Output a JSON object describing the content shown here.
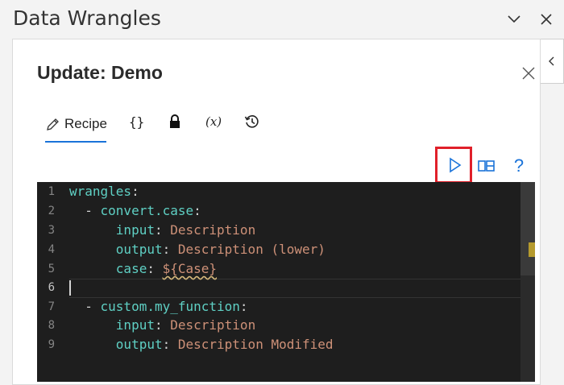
{
  "pane": {
    "title": "Data Wrangles",
    "icons": [
      "chevron-down-icon",
      "close-icon"
    ]
  },
  "panel": {
    "title": "Update: Demo"
  },
  "tabs": [
    {
      "name": "recipe",
      "label": "Recipe",
      "icon": "pencil-icon",
      "active": true
    },
    {
      "name": "json",
      "label": "{}",
      "icon": "braces-icon"
    },
    {
      "name": "lock",
      "label": "",
      "icon": "lock-icon"
    },
    {
      "name": "variables",
      "label": "(x)",
      "icon": "variable-icon"
    },
    {
      "name": "history",
      "label": "",
      "icon": "history-icon"
    }
  ],
  "toolbar": {
    "run_icon": "play-icon",
    "split_icon": "split-view-icon",
    "help_label": "?"
  },
  "colors": {
    "accent": "#1a73d9",
    "highlight": "#e0202a",
    "editor_bg": "#1e1e1e",
    "key": "#5fd0c4",
    "string": "#ce9178"
  },
  "editor": {
    "current_line": 6,
    "lines": [
      {
        "n": "1",
        "indent": "",
        "key": "wrangles",
        "sep": ":",
        "val": ""
      },
      {
        "n": "2",
        "indent": "  - ",
        "key": "convert.case",
        "sep": ":",
        "val": ""
      },
      {
        "n": "3",
        "indent": "      ",
        "key": "input",
        "sep": ": ",
        "val": "Description"
      },
      {
        "n": "4",
        "indent": "      ",
        "key": "output",
        "sep": ": ",
        "val": "Description (lower)"
      },
      {
        "n": "5",
        "indent": "      ",
        "key": "case",
        "sep": ": ",
        "val": "${Case}"
      },
      {
        "n": "6",
        "indent": "",
        "key": "",
        "sep": "",
        "val": ""
      },
      {
        "n": "7",
        "indent": "  - ",
        "key": "custom.my_function",
        "sep": ":",
        "val": ""
      },
      {
        "n": "8",
        "indent": "      ",
        "key": "input",
        "sep": ": ",
        "val": "Description"
      },
      {
        "n": "9",
        "indent": "      ",
        "key": "output",
        "sep": ": ",
        "val": "Description Modified"
      }
    ]
  }
}
